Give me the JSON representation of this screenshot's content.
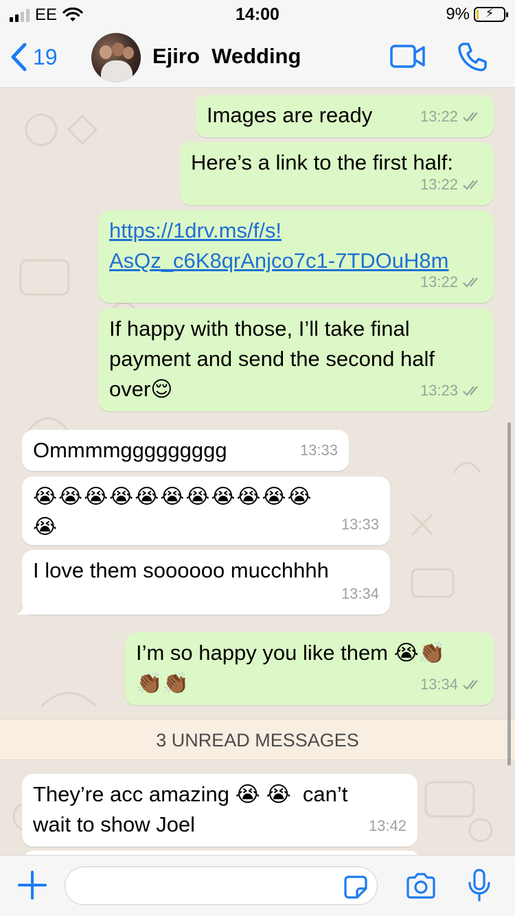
{
  "status_bar": {
    "carrier": "EE",
    "time": "14:00",
    "battery": "9%",
    "battery_level": 0.09
  },
  "header": {
    "back_count": "19",
    "title": "Ejiro  Wedding"
  },
  "messages": [
    {
      "dir": "out",
      "text": "Images are ready",
      "time": "13:22"
    },
    {
      "dir": "out",
      "text": "Here’s a link to the first half:",
      "time": "13:22"
    },
    {
      "dir": "out",
      "text": "https://1drv.ms/f/s!\nAsQz_c6K8qrAnjco7c1-7TDOuH8m",
      "time": "13:22"
    },
    {
      "dir": "out",
      "text": "If happy with those, I’ll take final\npayment and send the second half\nover😌",
      "time": "13:23"
    },
    {
      "dir": "in",
      "text": "Ommmmggggggggg",
      "time": "13:33"
    },
    {
      "dir": "in",
      "text": "😭😭😭😭😭😭😭😭😭😭😭\n😭",
      "time": "13:33"
    },
    {
      "dir": "in",
      "text": "I love them soooooo mucchhhh",
      "time": "13:34"
    },
    {
      "dir": "out",
      "text": "I’m so happy you like them 😭👏🏾\n👏🏾👏🏾",
      "time": "13:34"
    },
    {
      "dir": "in",
      "text": "They’re acc amazing 😭 😭  can’t\nwait to show Joel",
      "time": "13:42"
    }
  ],
  "unread_banner": "3 UNREAD MESSAGES",
  "input": {
    "value": "",
    "placeholder": ""
  },
  "icons": {
    "back": "chevron-left-icon",
    "video": "video-camera-icon",
    "call": "phone-icon",
    "add": "plus-icon",
    "sticker": "sticker-icon",
    "camera": "camera-icon",
    "mic": "microphone-icon"
  },
  "colors": {
    "accent": "#1d7cf2",
    "outgoing_bubble": "#dcf8c6",
    "incoming_bubble": "#ffffff",
    "chat_bg": "#ece5dd",
    "unread_banner": "#f8eee1"
  }
}
